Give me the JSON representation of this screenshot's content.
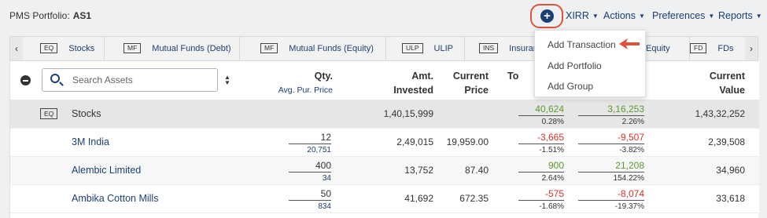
{
  "portfolio": {
    "label": "PMS Portfolio:",
    "name": "AS1"
  },
  "toolbar": {
    "add_symbol": "+",
    "menus": [
      "XIRR",
      "Actions",
      "Preferences",
      "Reports"
    ]
  },
  "tabs": {
    "prev": "‹",
    "next": "›",
    "items": [
      {
        "badge": "EQ",
        "label": "Stocks"
      },
      {
        "badge": "MF",
        "label": "Mutual Funds (Debt)"
      },
      {
        "badge": "MF",
        "label": "Mutual Funds (Equity)"
      },
      {
        "badge": "ULP",
        "label": "ULIP"
      },
      {
        "badge": "INS",
        "label": "Insurance"
      },
      {
        "badge": "",
        "label": "Equity"
      },
      {
        "badge": "FD",
        "label": "FDs"
      }
    ]
  },
  "search": {
    "placeholder": "Search Assets"
  },
  "columns": {
    "qty": "Qty.",
    "qty_sub": "Avg. Pur. Price",
    "amt_line1": "Amt.",
    "amt_line2": "Invested",
    "price_line1": "Current",
    "price_line2": "Price",
    "today": "To",
    "value_line1": "Current",
    "value_line2": "Value"
  },
  "group": {
    "badge": "EQ",
    "name": "Stocks",
    "invested": "1,40,15,999",
    "today_gain": "40,624",
    "today_pct": "0.28%",
    "overall_gain": "3,16,253",
    "overall_pct": "2.26%",
    "current_value": "1,43,32,252"
  },
  "rows": [
    {
      "name": "3M India",
      "qty": "12",
      "avg_price": "20,751",
      "invested": "2,49,015",
      "price": "19,959.00",
      "today_gain": "-3,665",
      "today_pct": "-1.51%",
      "overall_gain": "-9,507",
      "overall_pct": "-3.82%",
      "value": "2,39,508"
    },
    {
      "name": "Alembic Limited",
      "qty": "400",
      "avg_price": "34",
      "invested": "13,752",
      "price": "87.40",
      "today_gain": "900",
      "today_pct": "2.64%",
      "overall_gain": "21,208",
      "overall_pct": "154.22%",
      "value": "34,960"
    },
    {
      "name": "Ambika Cotton Mills",
      "qty": "50",
      "avg_price": "834",
      "invested": "41,692",
      "price": "672.35",
      "today_gain": "-575",
      "today_pct": "-1.68%",
      "overall_gain": "-8,074",
      "overall_pct": "-19.37%",
      "value": "33,618"
    }
  ],
  "add_menu": {
    "items": [
      "Add Transaction",
      "Add Portfolio",
      "Add Group"
    ]
  },
  "colors": {
    "brand": "#1b3f73",
    "highlight": "#e0523a",
    "gain": "#5a9a2e",
    "loss": "#d2322d"
  }
}
